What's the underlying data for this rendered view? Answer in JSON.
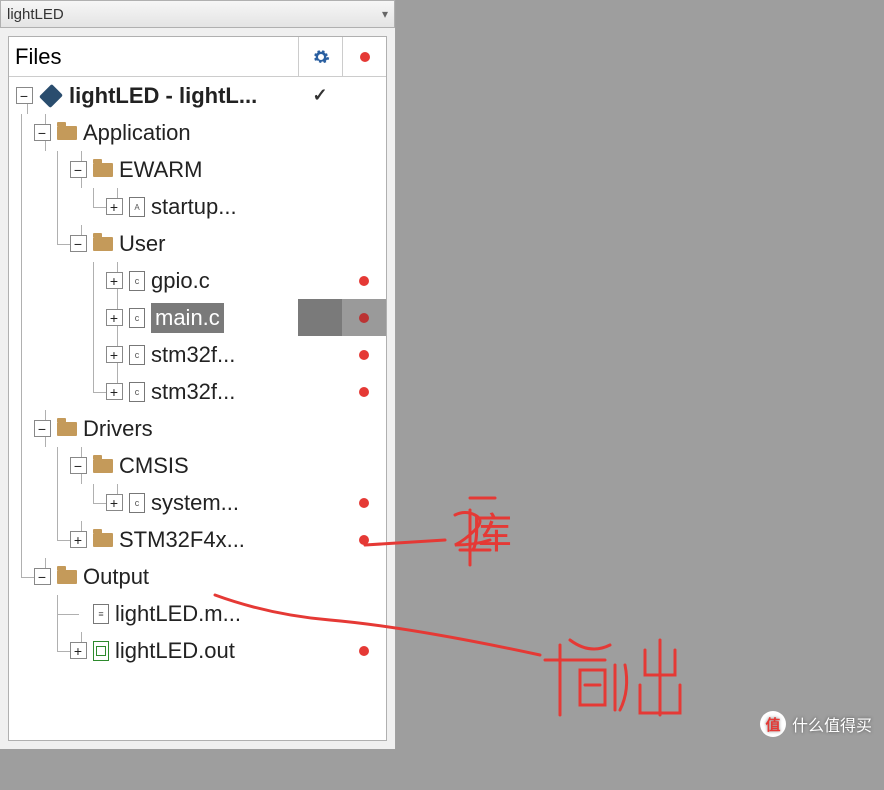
{
  "panel": {
    "title": "lightLED",
    "columns": {
      "name": "Files",
      "gear_icon": "gear-icon",
      "dot_icon": "status-dot"
    }
  },
  "tree": {
    "project": {
      "label": "lightLED - lightL...",
      "gear": "check",
      "dot": ""
    },
    "nodes": [
      {
        "id": "app",
        "label": "Application"
      },
      {
        "id": "ewarm",
        "label": "EWARM"
      },
      {
        "id": "startup",
        "label": "startup..."
      },
      {
        "id": "user",
        "label": "User"
      },
      {
        "id": "gpio",
        "label": "gpio.c",
        "dot": true
      },
      {
        "id": "main",
        "label": "main.c",
        "dot": true,
        "selected": true
      },
      {
        "id": "stm1",
        "label": "stm32f...",
        "dot": true
      },
      {
        "id": "stm2",
        "label": "stm32f...",
        "dot": true
      },
      {
        "id": "drivers",
        "label": "Drivers"
      },
      {
        "id": "cmsis",
        "label": "CMSIS"
      },
      {
        "id": "system",
        "label": "system...",
        "dot": true
      },
      {
        "id": "stm32f4",
        "label": "STM32F4x...",
        "dot": true
      },
      {
        "id": "output",
        "label": "Output"
      },
      {
        "id": "ledm",
        "label": "lightLED.m..."
      },
      {
        "id": "ledout",
        "label": "lightLED.out",
        "dot": true
      }
    ]
  },
  "annotations": {
    "lib": "库",
    "output": "输出"
  },
  "watermark": {
    "badge": "值",
    "text": "什么值得买"
  }
}
